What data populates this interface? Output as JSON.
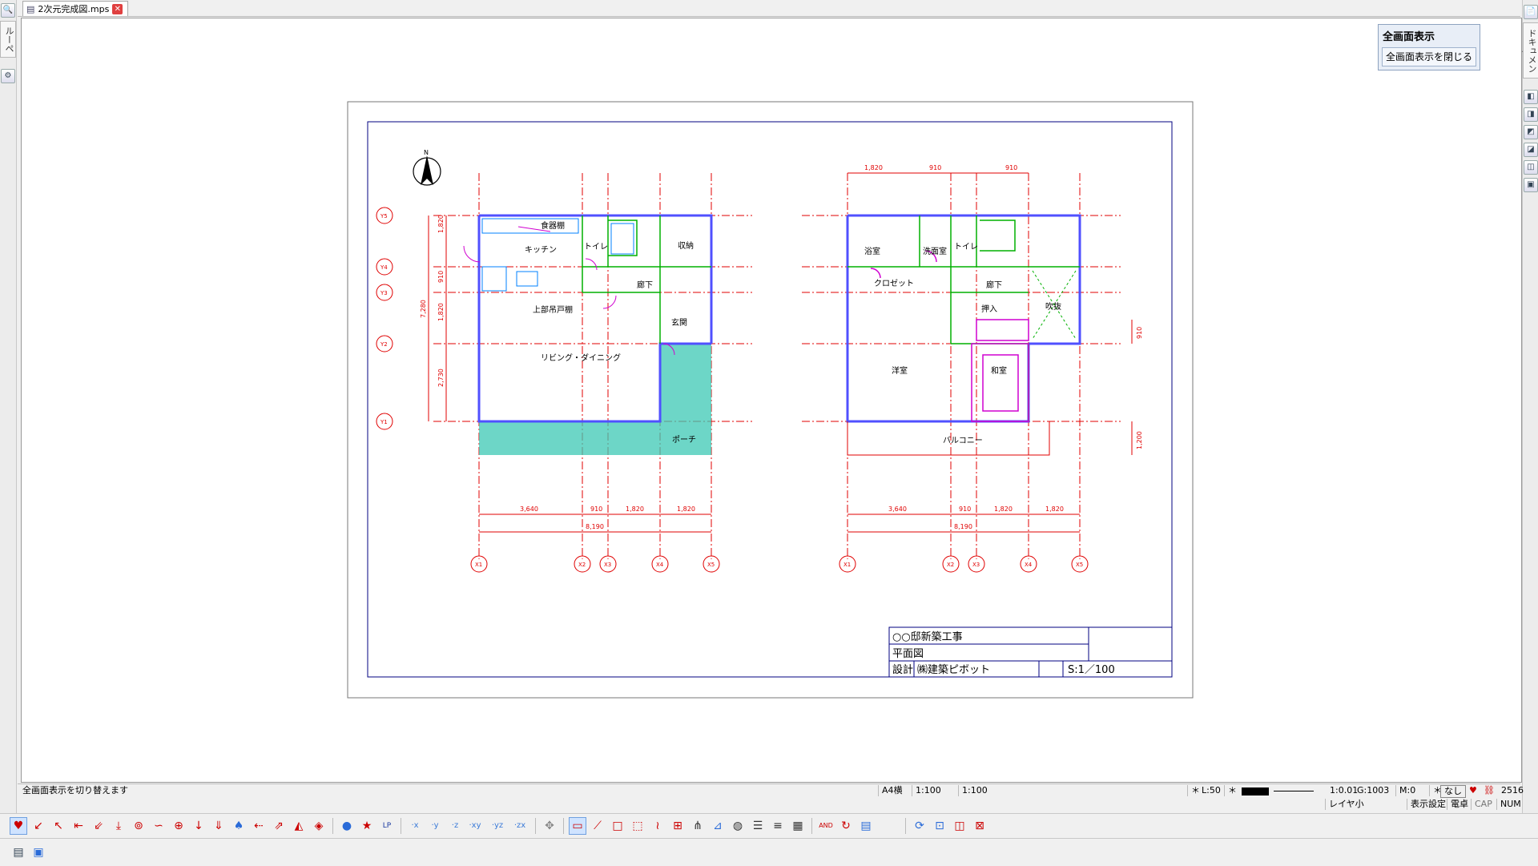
{
  "tab": {
    "filename": "2次元完成図.mps",
    "close_glyph": "✕"
  },
  "left_dock": {
    "tab_label": "ルーペ"
  },
  "right_dock": {
    "tab_label": "ドキュメント"
  },
  "fullscreen_panel": {
    "title": "全画面表示",
    "close_button": "全画面表示を閉じる"
  },
  "drawing": {
    "north": "N",
    "title_block": {
      "project": "○○邸新築工事",
      "drawing_name": "平面図",
      "design_label": "設計",
      "company": "㈱建築ピボット",
      "scale": "S:1／100"
    },
    "plan1": {
      "rooms": {
        "shelf": "食器棚",
        "kitchen": "キッチン",
        "toilet": "トイレ",
        "storage": "収納",
        "hall": "廊下",
        "upper_cabinet": "上部吊戸棚",
        "entrance": "玄関",
        "living": "リビング・ダイニング",
        "porch": "ポーチ"
      },
      "dims_bottom": [
        "3,640",
        "910",
        "1,820",
        "1,820"
      ],
      "dim_total": "8,190",
      "dims_left": [
        "1,820",
        "910",
        "1,820",
        "2,730"
      ],
      "dim_left_total": "7,280",
      "grid_x": [
        "X1",
        "X2",
        "X3",
        "X4",
        "X5"
      ],
      "grid_y": [
        "Y5",
        "Y4",
        "Y3",
        "Y2",
        "Y1"
      ]
    },
    "plan2": {
      "rooms": {
        "bath": "浴室",
        "washroom": "洗面室",
        "toilet": "トイレ",
        "closet": "クロゼット",
        "hall": "廊下",
        "oshiire": "押入",
        "void": "吹抜",
        "western": "洋室",
        "japanese": "和室",
        "balcony": "バルコニー"
      },
      "dims_top": [
        "1,820",
        "910",
        "910"
      ],
      "dims_bottom": [
        "3,640",
        "910",
        "1,820",
        "1,820"
      ],
      "dim_total": "8,190",
      "dims_right": [
        "910",
        "1,200"
      ],
      "grid_x": [
        "X1",
        "X2",
        "X3",
        "X4",
        "X5"
      ]
    }
  },
  "status": {
    "hint": "全画面表示を切り替えます",
    "paper": "A4横",
    "scale1": "1:100",
    "scale2": "1:100",
    "star1": "＊",
    "layer": "L:50",
    "star2": "＊",
    "ratio": "1:0.01",
    "group": "G:1003",
    "mode": "M:0",
    "star3": "＊",
    "none": "なし",
    "count": "2516",
    "layer_name": "レイヤ小",
    "display_settings": "表示設定",
    "calculator": "電卓",
    "cap": "CAP",
    "num": "NUM"
  },
  "toolbar_icons": [
    "heart-icon",
    "arrow-sw-icon",
    "arrow-nw-icon",
    "arrow-w-icon",
    "arrow-sw2-icon",
    "arrow-down-icon",
    "pin-icon",
    "curve-icon",
    "crosshair-icon",
    "arrow-down2-icon",
    "arrow-down3-icon",
    "spade-icon",
    "arrow-w2-icon",
    "arrow-ne-icon",
    "shape-icon",
    "object-icon",
    "drop-icon",
    "star-icon",
    "lp-icon",
    "x-axis-icon",
    "y-axis-icon",
    "z-axis-icon",
    "xy-icon",
    "yz-icon",
    "zx-icon",
    "move-icon",
    "select-rect-icon",
    "line-icon",
    "square-icon",
    "dash-square-icon",
    "wave-icon",
    "grid-icon",
    "fork-icon",
    "ruler-icon",
    "fill-icon",
    "hatch1-icon",
    "hatch2-icon",
    "pattern-icon",
    "and-icon",
    "curve2-icon",
    "window-icon",
    "cycle-icon",
    "zoom-icon",
    "layers-icon",
    "net-icon"
  ],
  "colors": {
    "canvas": "#ffffff",
    "frame": "#000080",
    "grid_line": "#e00000",
    "wall": "#5050ff",
    "accent": "#e00000"
  }
}
